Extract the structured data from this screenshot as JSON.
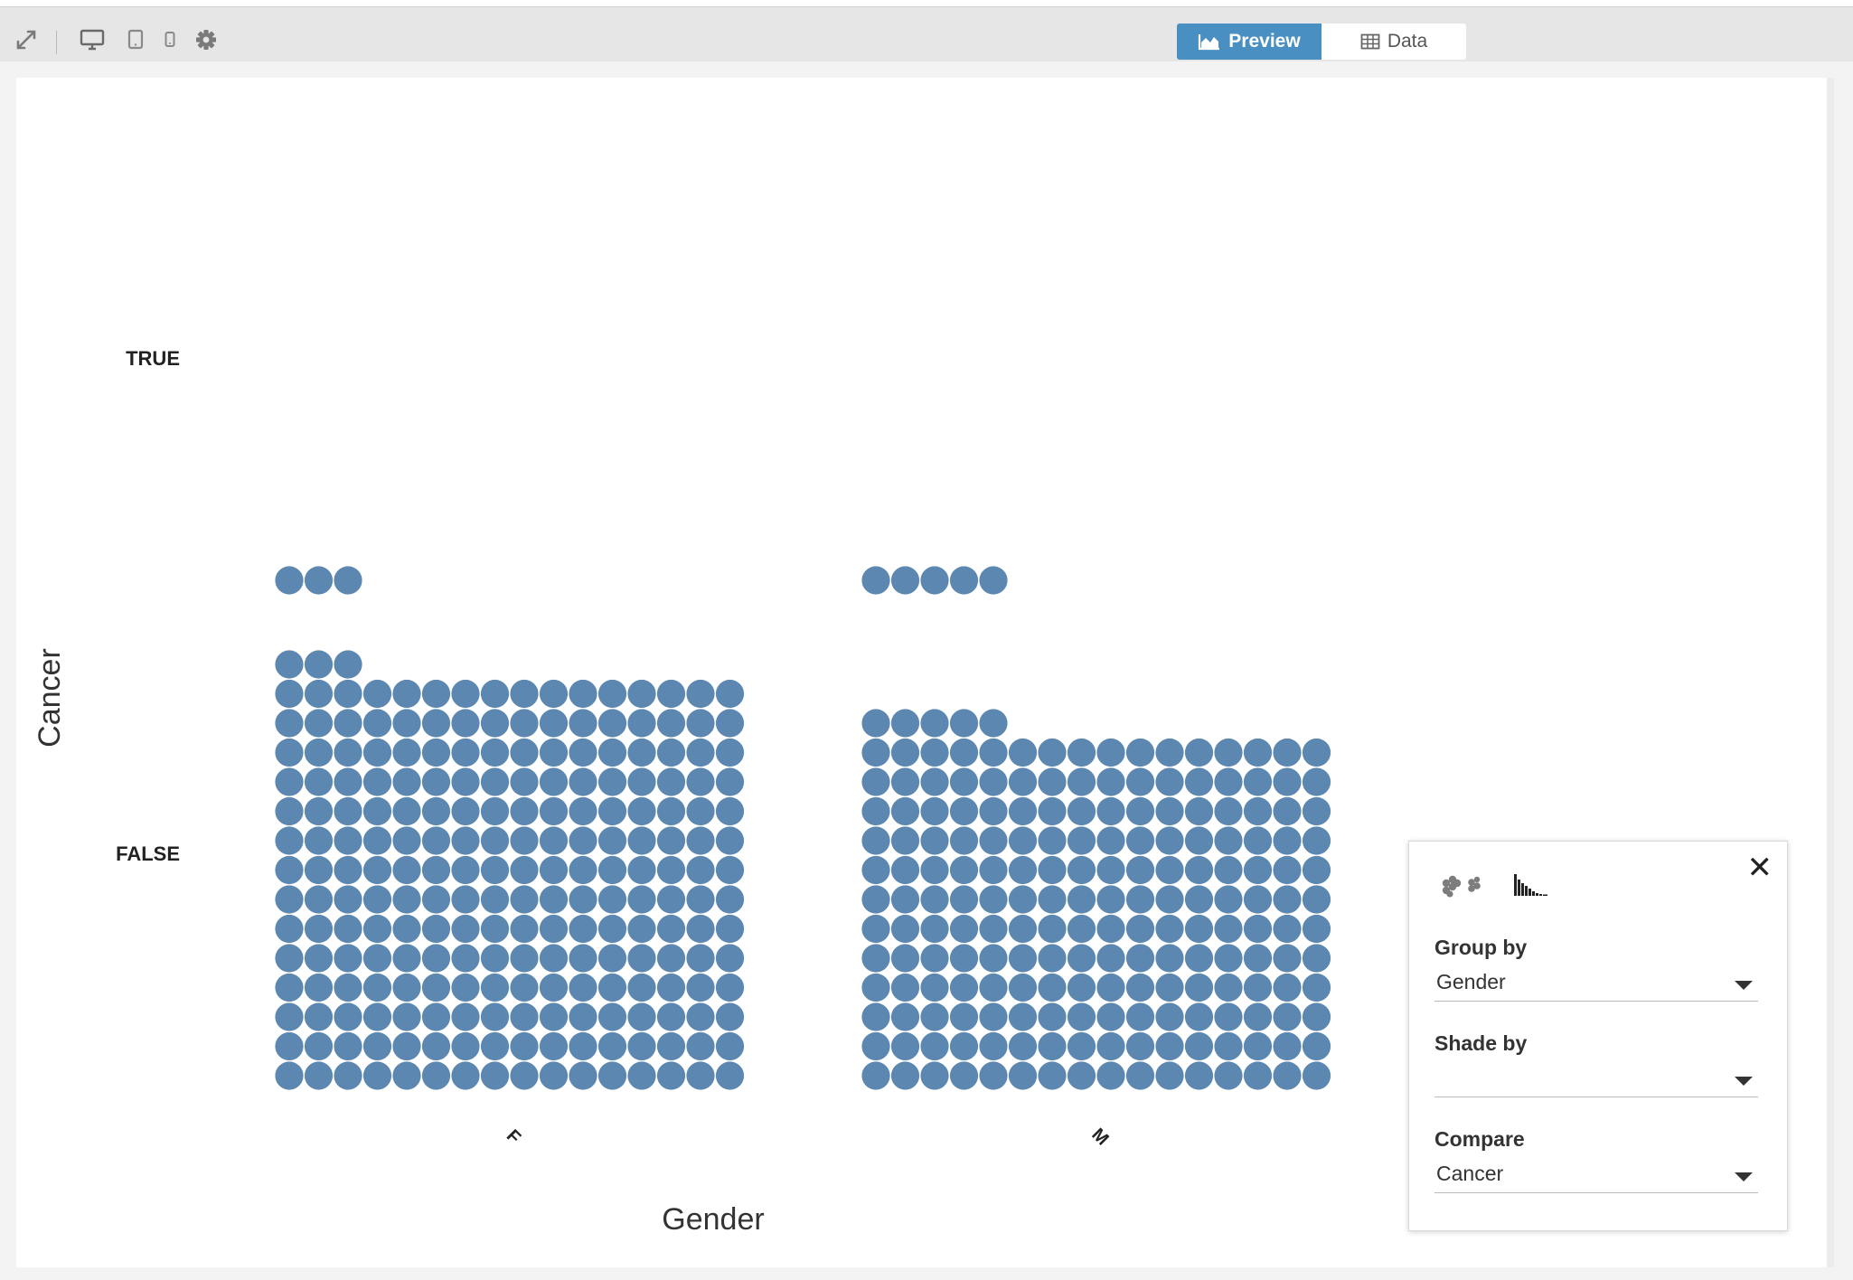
{
  "toolbar": {
    "icons": [
      "expand-icon",
      "desktop-icon",
      "tablet-icon",
      "phone-icon",
      "gear-icon"
    ],
    "tabs": {
      "preview": "Preview",
      "data": "Data"
    },
    "active_tab": "preview",
    "accent": "#4a8fc1"
  },
  "panel": {
    "view_icons": [
      "bubble-view-icon",
      "histogram-view-icon"
    ],
    "group_by": {
      "label": "Group by",
      "value": "Gender"
    },
    "shade_by": {
      "label": "Shade by",
      "value": ""
    },
    "compare": {
      "label": "Compare",
      "value": "Cancer"
    }
  },
  "chart_data": {
    "type": "scatter",
    "subtype": "dot-plot (one dot per record)",
    "xlabel": "Gender",
    "ylabel": "Cancer",
    "x_categories": [
      "F",
      "M"
    ],
    "y_categories": [
      "TRUE",
      "FALSE"
    ],
    "counts": {
      "F": {
        "TRUE": 3,
        "FALSE": 227
      },
      "M": {
        "TRUE": 5,
        "FALSE": 197
      }
    },
    "dot_color": "#5b87b0",
    "grid": false
  }
}
